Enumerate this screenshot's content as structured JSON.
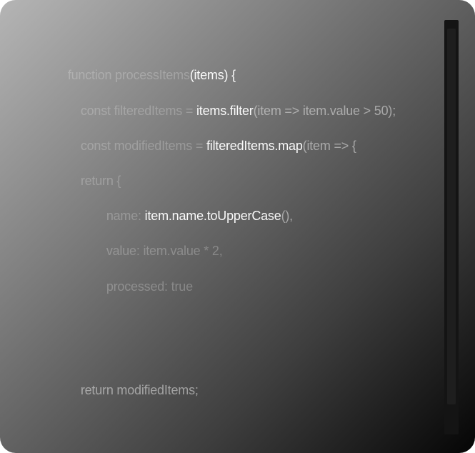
{
  "editor": {
    "line1": {
      "a": "function processItems",
      "b": "(items) {"
    },
    "line2": {
      "a": "const filteredItems = ",
      "b": "items.filter",
      "c": "(item => item.value > 50);"
    },
    "line3": {
      "a": "const modifiedItems = ",
      "b": "filteredItems.map",
      "c": "(item => {"
    },
    "line4": {
      "a": "return {"
    },
    "line5": {
      "a": "name: ",
      "b": "item.name.toUpperCase",
      "c": "(),"
    },
    "line6": {
      "a": "value: item.value * 2,"
    },
    "line7": {
      "a": "processed: true"
    },
    "line8": {
      "a": "return modifiedItems;"
    }
  },
  "scrollbar": {
    "icon": "vertical-scrollbar"
  }
}
